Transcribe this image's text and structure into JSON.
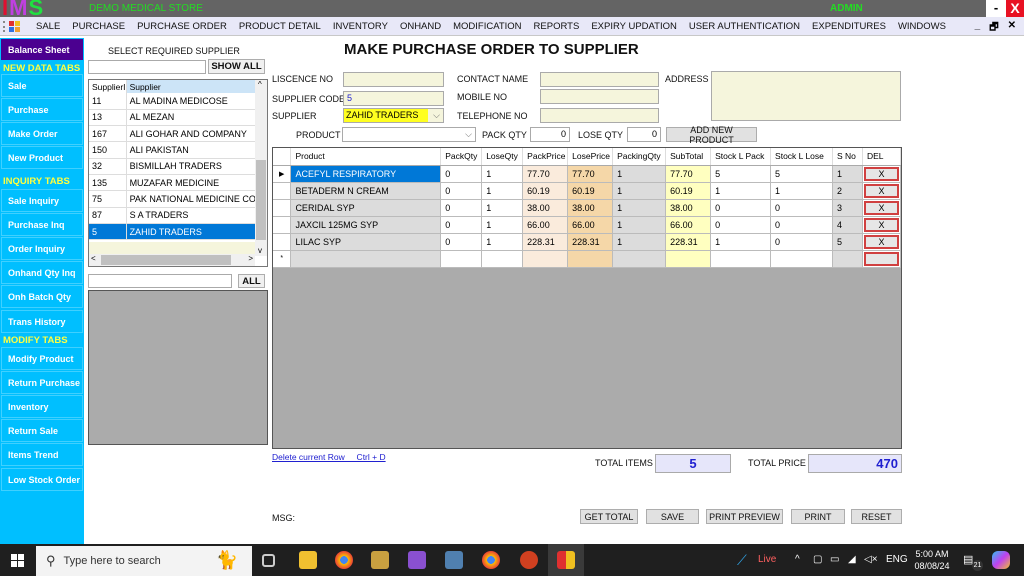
{
  "titlebar": {
    "logo": {
      "i": "I",
      "m": "M",
      "s": "S"
    },
    "store_name": "DEMO MEDICAL STORE",
    "user": "ADMIN",
    "minimize": "-",
    "close": "X"
  },
  "menu": {
    "items": [
      "SALE",
      "PURCHASE",
      "PURCHASE ORDER",
      "PRODUCT DETAIL",
      "INVENTORY",
      "ONHAND",
      "MODIFICATION",
      "REPORTS",
      "EXPIRY UPDATION",
      "USER AUTHENTICATION",
      "EXPENDITURES",
      "WINDOWS"
    ],
    "mdi": {
      "minimize": "_",
      "restore": "🗗",
      "close": "✕"
    }
  },
  "sidebar": {
    "balance_sheet": "Balance Sheet",
    "sections": [
      {
        "heading": "NEW DATA TABS",
        "items": [
          "Sale",
          "Purchase",
          "Make Order",
          "New Product"
        ]
      },
      {
        "heading": "INQUIRY TABS",
        "items": [
          "Sale Inquiry",
          "Purchase Inq",
          "Order Inquiry",
          "Onhand Qty Inq",
          "Onh Batch Qty",
          "Trans History"
        ]
      },
      {
        "heading": "MODIFY TABS",
        "items": [
          "Modify Product",
          "Return Purchase",
          "Inventory",
          "Return Sale",
          "Items Trend",
          "Low Stock Order"
        ]
      }
    ]
  },
  "supplier_panel": {
    "label": "SELECT REQUIRED SUPPLIER",
    "search_value": "",
    "show_all": "SHOW ALL",
    "columns": [
      "SupplierI",
      "Supplier"
    ],
    "rows": [
      {
        "id": "11",
        "name": "AL MADINA MEDICOSE"
      },
      {
        "id": "13",
        "name": "AL MEZAN"
      },
      {
        "id": "167",
        "name": "ALI GOHAR AND COMPANY"
      },
      {
        "id": "150",
        "name": "ALI PAKISTAN"
      },
      {
        "id": "32",
        "name": "BISMILLAH TRADERS"
      },
      {
        "id": "135",
        "name": "MUZAFAR MEDICINE"
      },
      {
        "id": "75",
        "name": "PAK NATIONAL MEDICINE COMP"
      },
      {
        "id": "87",
        "name": "S A TRADERS"
      },
      {
        "id": "5",
        "name": "ZAHID TRADERS"
      }
    ],
    "selected_index": 8,
    "filter_value": "",
    "all_button": "ALL"
  },
  "form": {
    "title": "MAKE PURCHASE ORDER TO SUPPLIER",
    "licence_label": "LISCENCE NO",
    "licence_value": "",
    "supplier_code_label": "SUPPLIER CODE",
    "supplier_code_value": "5",
    "supplier_label": "SUPPLIER",
    "supplier_value": "ZAHID TRADERS",
    "contact_label": "CONTACT NAME",
    "contact_value": "",
    "mobile_label": "MOBILE NO",
    "mobile_value": "",
    "telephone_label": "TELEPHONE NO",
    "telephone_value": "",
    "address_label": "ADDRESS",
    "address_value": "",
    "product_label": "PRODUCT",
    "product_value": "",
    "pack_qty_label": "PACK QTY",
    "pack_qty_value": "0",
    "lose_qty_label": "LOSE QTY",
    "lose_qty_value": "0",
    "add_new_product": "ADD NEW PRODUCT"
  },
  "grid": {
    "columns": [
      "Product",
      "PackQty",
      "LoseQty",
      "PackPrice",
      "LosePrice",
      "PackingQty",
      "SubTotal",
      "Stock L Pack",
      "Stock L Lose",
      "S No",
      "DEL"
    ],
    "rows": [
      {
        "product": "ACEFYL RESPIRATORY",
        "pack_qty": "0",
        "lose_qty": "1",
        "pack_price": "77.70",
        "lose_price": "77.70",
        "packing_qty": "1",
        "subtotal": "77.70",
        "stock_pack": "5",
        "stock_lose": "5",
        "sno": "1",
        "del": "X"
      },
      {
        "product": "BETADERM N CREAM",
        "pack_qty": "0",
        "lose_qty": "1",
        "pack_price": "60.19",
        "lose_price": "60.19",
        "packing_qty": "1",
        "subtotal": "60.19",
        "stock_pack": "1",
        "stock_lose": "1",
        "sno": "2",
        "del": "X"
      },
      {
        "product": "CERIDAL SYP",
        "pack_qty": "0",
        "lose_qty": "1",
        "pack_price": "38.00",
        "lose_price": "38.00",
        "packing_qty": "1",
        "subtotal": "38.00",
        "stock_pack": "0",
        "stock_lose": "0",
        "sno": "3",
        "del": "X"
      },
      {
        "product": "JAXCIL 125MG SYP",
        "pack_qty": "0",
        "lose_qty": "1",
        "pack_price": "66.00",
        "lose_price": "66.00",
        "packing_qty": "1",
        "subtotal": "66.00",
        "stock_pack": "0",
        "stock_lose": "0",
        "sno": "4",
        "del": "X"
      },
      {
        "product": "LILAC SYP",
        "pack_qty": "0",
        "lose_qty": "1",
        "pack_price": "228.31",
        "lose_price": "228.31",
        "packing_qty": "1",
        "subtotal": "228.31",
        "stock_pack": "1",
        "stock_lose": "0",
        "sno": "5",
        "del": "X"
      }
    ],
    "current_row_marker": "▶",
    "new_row_marker": "*"
  },
  "footer": {
    "delete_link": "Delete current Row     Ctrl + D",
    "total_items_label": "TOTAL ITEMS",
    "total_items": "5",
    "total_price_label": "TOTAL PRICE",
    "total_price": "470",
    "msg_label": "MSG:",
    "buttons": [
      "GET TOTAL",
      "SAVE",
      "PRINT PREVIEW",
      "PRINT",
      "RESET"
    ]
  },
  "taskbar": {
    "search_placeholder": "Type here to search",
    "weather": "Live",
    "language": "ENG",
    "time": "5:00 AM",
    "date": "08/08/24",
    "notifications": "21"
  }
}
